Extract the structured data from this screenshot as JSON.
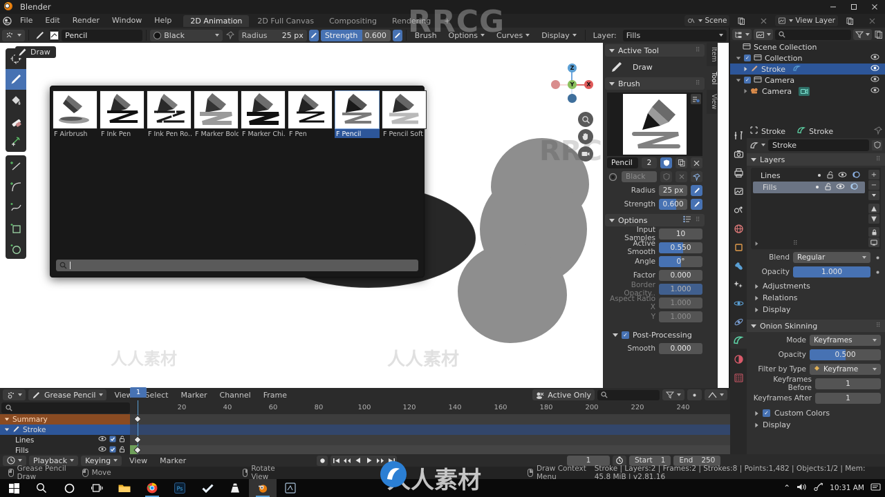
{
  "window": {
    "title": "Blender",
    "buttons": [
      "minimize",
      "maximize",
      "close"
    ]
  },
  "topbar": {
    "menus": [
      "File",
      "Edit",
      "Render",
      "Window",
      "Help"
    ],
    "workspaces": [
      {
        "label": "2D Animation",
        "active": true
      },
      {
        "label": "2D Full Canvas",
        "active": false
      },
      {
        "label": "Compositing",
        "active": false
      },
      {
        "label": "Rendering",
        "active": false
      }
    ],
    "add_workspace": "+",
    "scene_label": "Scene",
    "viewlayer_label": "View Layer"
  },
  "tool_settings": {
    "brush_name": "Pencil",
    "color_name": "Black",
    "radius_label": "Radius",
    "radius_value": "25 px",
    "strength_label": "Strength",
    "strength_value": "0.600",
    "strength_fill_pct": 60,
    "menus": [
      "Brush",
      "Options",
      "Curves",
      "Display"
    ],
    "layer_label": "Layer:",
    "layer_value": "Fills"
  },
  "brush_popup": {
    "brushes": [
      {
        "name": "F Airbrush",
        "selected": false
      },
      {
        "name": "F Ink Pen",
        "selected": false
      },
      {
        "name": "F Ink Pen Ro..",
        "selected": false
      },
      {
        "name": "F Marker Bold",
        "selected": false
      },
      {
        "name": "F Marker Chi..",
        "selected": false
      },
      {
        "name": "F Pen",
        "selected": false
      },
      {
        "name": "F Pencil",
        "selected": true
      },
      {
        "name": "F Pencil Soft",
        "selected": false
      }
    ],
    "search_placeholder": ""
  },
  "toolbar": {
    "active_tool_tip": "Draw",
    "tools": [
      {
        "name": "cursor-tool",
        "active": false
      },
      {
        "name": "draw-tool",
        "active": true
      },
      {
        "name": "fill-tool",
        "active": false
      },
      {
        "name": "erase-tool",
        "active": false
      },
      {
        "name": "cutter-tool",
        "active": false
      },
      {
        "name": "line-tool",
        "active": false
      },
      {
        "name": "arc-tool",
        "active": false
      },
      {
        "name": "curve-tool",
        "active": false
      },
      {
        "name": "box-tool",
        "active": false
      },
      {
        "name": "circle-tool",
        "active": false
      }
    ]
  },
  "gizmo": {
    "axes": [
      "X",
      "Y",
      "Z"
    ]
  },
  "npanel": {
    "tabs": [
      {
        "label": "Item",
        "active": false
      },
      {
        "label": "Tool",
        "active": true
      },
      {
        "label": "View",
        "active": false
      }
    ],
    "active_tool": {
      "title": "Active Tool",
      "tool_name": "Draw"
    },
    "brush": {
      "title": "Brush",
      "name": "Pencil",
      "users": "2",
      "color_name": "Black",
      "rows": [
        {
          "label": "Radius",
          "value": "25 px",
          "slider": false
        },
        {
          "label": "Strength",
          "value": "0.600",
          "slider": true,
          "fill_pct": 60
        }
      ]
    },
    "options": {
      "title": "Options",
      "rows": [
        {
          "label": "Input Samples",
          "value": "10",
          "slider": false,
          "dim": false
        },
        {
          "label": "Active Smooth",
          "value": "0.550",
          "slider": true,
          "fill_pct": 55,
          "dim": false
        },
        {
          "label": "Angle",
          "value": "0°",
          "slider": true,
          "fill_pct": 50,
          "dim": false
        },
        {
          "label": "Factor",
          "value": "0.000",
          "slider": false,
          "dim": false
        },
        {
          "label": "Border Opacity..",
          "value": "1.000",
          "slider": true,
          "fill_pct": 100,
          "dim": true
        },
        {
          "label": "Aspect Ratio X",
          "value": "1.000",
          "slider": false,
          "dim": true
        },
        {
          "label": "Y",
          "value": "1.000",
          "slider": false,
          "dim": true
        }
      ],
      "post_processing_label": "Post-Processing",
      "post_processing_checked": true,
      "smooth_label": "Smooth",
      "smooth_value": "0.000"
    }
  },
  "outliner": {
    "search_placeholder": "",
    "rows": [
      {
        "label": "Scene Collection",
        "indent": 0,
        "selected": false,
        "icon": "collection-icon",
        "eye": false,
        "checkbox": false
      },
      {
        "label": "Collection",
        "indent": 1,
        "selected": false,
        "icon": "collection-icon",
        "eye": true,
        "checkbox": true
      },
      {
        "label": "Stroke",
        "indent": 2,
        "selected": true,
        "icon": "grease-pencil-icon",
        "eye": true,
        "checkbox": false
      },
      {
        "label": "Camera",
        "indent": 1,
        "selected": false,
        "icon": "collection-icon",
        "eye": true,
        "checkbox": true
      },
      {
        "label": "Camera",
        "indent": 2,
        "selected": false,
        "icon": "camera-object-icon",
        "eye": true,
        "checkbox": false
      }
    ]
  },
  "properties": {
    "breadcrumb": [
      {
        "label": "Stroke",
        "icon": "object-icon"
      },
      {
        "label": "Stroke",
        "icon": "grease-pencil-icon"
      }
    ],
    "datablock_name": "Stroke",
    "tabs": [
      {
        "name": "tool-tab",
        "active": false
      },
      {
        "name": "render-tab",
        "active": false
      },
      {
        "name": "output-tab",
        "active": false
      },
      {
        "name": "viewlayer-tab",
        "active": false
      },
      {
        "name": "scene-tab",
        "active": false
      },
      {
        "name": "world-tab",
        "active": false
      },
      {
        "name": "object-tab",
        "active": false
      },
      {
        "name": "modifier-tab",
        "active": false
      },
      {
        "name": "effects-tab",
        "active": false
      },
      {
        "name": "physics-tab",
        "active": false
      },
      {
        "name": "constraints-tab",
        "active": false
      },
      {
        "name": "data-tab",
        "active": true
      },
      {
        "name": "material-tab",
        "active": false
      },
      {
        "name": "texture-tab",
        "active": false
      }
    ],
    "layers": {
      "title": "Layers",
      "items": [
        {
          "name": "Lines",
          "selected": false
        },
        {
          "name": "Fills",
          "selected": true
        }
      ],
      "blend_label": "Blend",
      "blend_value": "Regular",
      "opacity_label": "Opacity",
      "opacity_value": "1.000",
      "opacity_fill_pct": 100,
      "subpanels": [
        "Adjustments",
        "Relations",
        "Display"
      ]
    },
    "onion_skinning": {
      "title": "Onion Skinning",
      "rows": [
        {
          "label": "Mode",
          "value": "Keyframes",
          "type": "dropdown"
        },
        {
          "label": "Opacity",
          "value": "0.500",
          "type": "slider",
          "fill_pct": 50
        },
        {
          "label": "Filter by Type",
          "value": "Keyframe",
          "type": "dropdown-icon"
        },
        {
          "label": "Keyframes Before",
          "value": "1",
          "type": "field"
        },
        {
          "label": "Keyframes After",
          "value": "1",
          "type": "field"
        }
      ],
      "custom_colors_label": "Custom Colors",
      "custom_colors_checked": true,
      "display_label": "Display"
    }
  },
  "dopesheet": {
    "mode": "Grease Pencil",
    "menus": [
      "View",
      "Select",
      "Marker",
      "Channel",
      "Frame"
    ],
    "active_only_label": "Active Only",
    "search_placeholder": "",
    "ruler_ticks": [
      "20",
      "40",
      "60",
      "80",
      "100",
      "120",
      "140",
      "160",
      "180",
      "200",
      "220",
      "240"
    ],
    "current_frame": "1",
    "channels": [
      {
        "label": "Summary",
        "type": "summary"
      },
      {
        "label": "Stroke",
        "type": "object",
        "selected": true
      },
      {
        "label": "Lines",
        "type": "layer"
      },
      {
        "label": "Fills",
        "type": "layer"
      }
    ]
  },
  "timeline_footer": {
    "playback_label": "Playback",
    "keying_label": "Keying",
    "menus": [
      "View",
      "Marker"
    ],
    "current_frame": "1",
    "start_label": "Start",
    "start_value": "1",
    "end_label": "End",
    "end_value": "250"
  },
  "statusbar": {
    "hints": [
      {
        "mouse": "left",
        "label": "Grease Pencil Draw"
      },
      {
        "mouse": "left-drag",
        "label": "Move"
      },
      {
        "mouse": "middle",
        "label": "Rotate View"
      },
      {
        "mouse": "right",
        "label": "Draw Context Menu"
      }
    ],
    "stats": "Stroke | Layers:2 | Frames:2 | Strokes:8 | Points:1,482 | Objects:1/2 | Mem: 45.8 MiB | v2.81.16"
  },
  "taskbar": {
    "items": [
      {
        "name": "start-button"
      },
      {
        "name": "search-icon"
      },
      {
        "name": "cortana-icon"
      },
      {
        "name": "task-view-icon"
      },
      {
        "name": "file-explorer-icon"
      },
      {
        "name": "chrome-icon"
      },
      {
        "name": "photoshop-icon"
      },
      {
        "name": "check-app-icon"
      },
      {
        "name": "vlc-icon"
      },
      {
        "name": "blender-icon"
      },
      {
        "name": "notes-icon"
      }
    ],
    "tray": {
      "chevron": "⌃",
      "volume": "volume-icon",
      "network": "network-icon",
      "time": "10:31 AM",
      "notification": "notification-icon"
    }
  },
  "watermarks": {
    "main": "RRCG",
    "chinese": "人人素材"
  },
  "colors": {
    "accent_blue": "#4772b3",
    "select_blue": "#2d5699",
    "panel_bg": "#303030",
    "editor_bg": "#282828",
    "header_bg": "#2b2b2b",
    "summary_orange": "#8a4b22"
  }
}
